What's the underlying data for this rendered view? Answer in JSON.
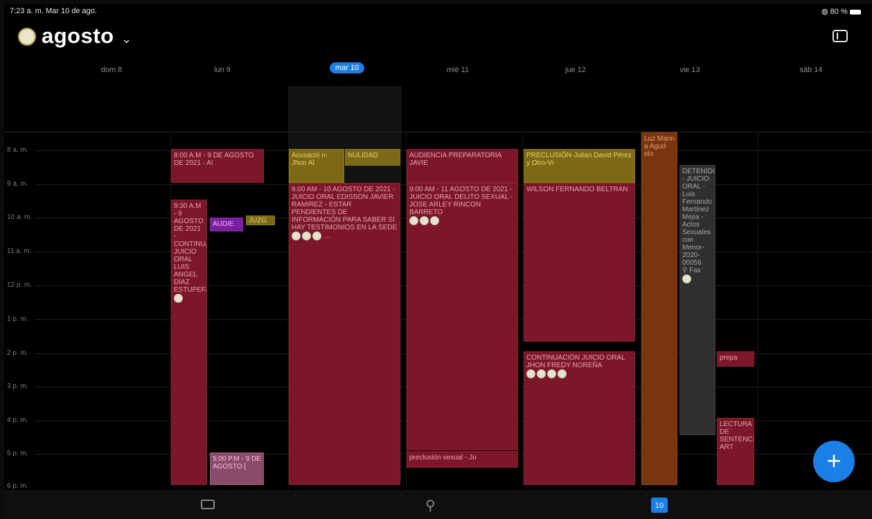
{
  "status_bar": {
    "time_date": "7:23 a. m.   Mar 10 de ago.",
    "battery": "80 %"
  },
  "header": {
    "month_title": "agosto",
    "chevron": "chevron-down-icon",
    "sidebar_icon": "sidebar-icon"
  },
  "days": [
    {
      "label": "dom 8"
    },
    {
      "label": "lun 9"
    },
    {
      "label": "mar 10"
    },
    {
      "label": "mié 11"
    },
    {
      "label": "jue 12"
    },
    {
      "label": "vie 13"
    },
    {
      "label": "sáb 14"
    }
  ],
  "hours": [
    "8 a. m.",
    "9 a. m.",
    "10 a. m.",
    "11 a. m.",
    "12 p. m.",
    "1 p. m.",
    "2 p. m.",
    "3 p. m.",
    "4 p. m.",
    "5 p. m.",
    "6 p. m."
  ],
  "events": {
    "lun_a": "8:00 A.M - 9 DE AGOSTO DE 2021 - A!",
    "lun_b": "9:30 A.M - 9 AGOSTO DE 2021 - CONTINUACIÓN JUICIO ORAL LUIS ANGEL DÍAZ ESTUPEFACIENTES...",
    "lun_c": "AUDIE",
    "lun_d": "JUZG",
    "lun_e": "5:00 P.M - 9 DE AGOSTO [",
    "mar_a": "Acusació n-Jhon Al",
    "mar_b": "NULIDAD",
    "mar_c": "9:00 AM - 10 AGOSTO DE 2021 - JUICIO ORAL EDISSON JAVIER RAMIREZ - ESTAR PENDIENTES DE INFORMACIÓN PARA SABER SI HAY TESTIMONIOS EN LA SEDE",
    "mar_more": "...",
    "mie_a": "AUDIENCIA PREPARATORIA JAVIE",
    "mie_b": "9:00 AM - 11 AGOSTO DE 2021 - JUICIO ORAL DELITO SEXUAL - JOSE ARLEY RINCON BARRETO",
    "mie_c": "preclusión sexual - Ju",
    "jue_a": "PRECLUSIÓN-Julian David Pérez y Otro-Vi",
    "jue_b": "WILSON FERNANDO BELTRAN",
    "jue_c": "CONTINUACIÓN JUICIO ORAL JHON FREDY NOREÑA",
    "vie_a": "Luz Marin a Agud elo",
    "vie_b": "DETENIDO - JUICIO ORAL -Luis Fernando Martínez Mejía - Actos Sexuales con Menor-2020-00056",
    "vie_loc": "Fax",
    "vie_c": "prepa",
    "vie_d": "LECTURA DE SENTENCIA ART"
  },
  "fab_label": "+",
  "tabbar": {
    "mail_icon": "mail-icon",
    "search_icon": "search-icon",
    "calendar_icon": "calendar-icon",
    "calendar_day": "10"
  },
  "colors": {
    "event_red": "#7b1728",
    "event_gold": "#7c6916",
    "accent_blue": "#1a7fe6"
  }
}
